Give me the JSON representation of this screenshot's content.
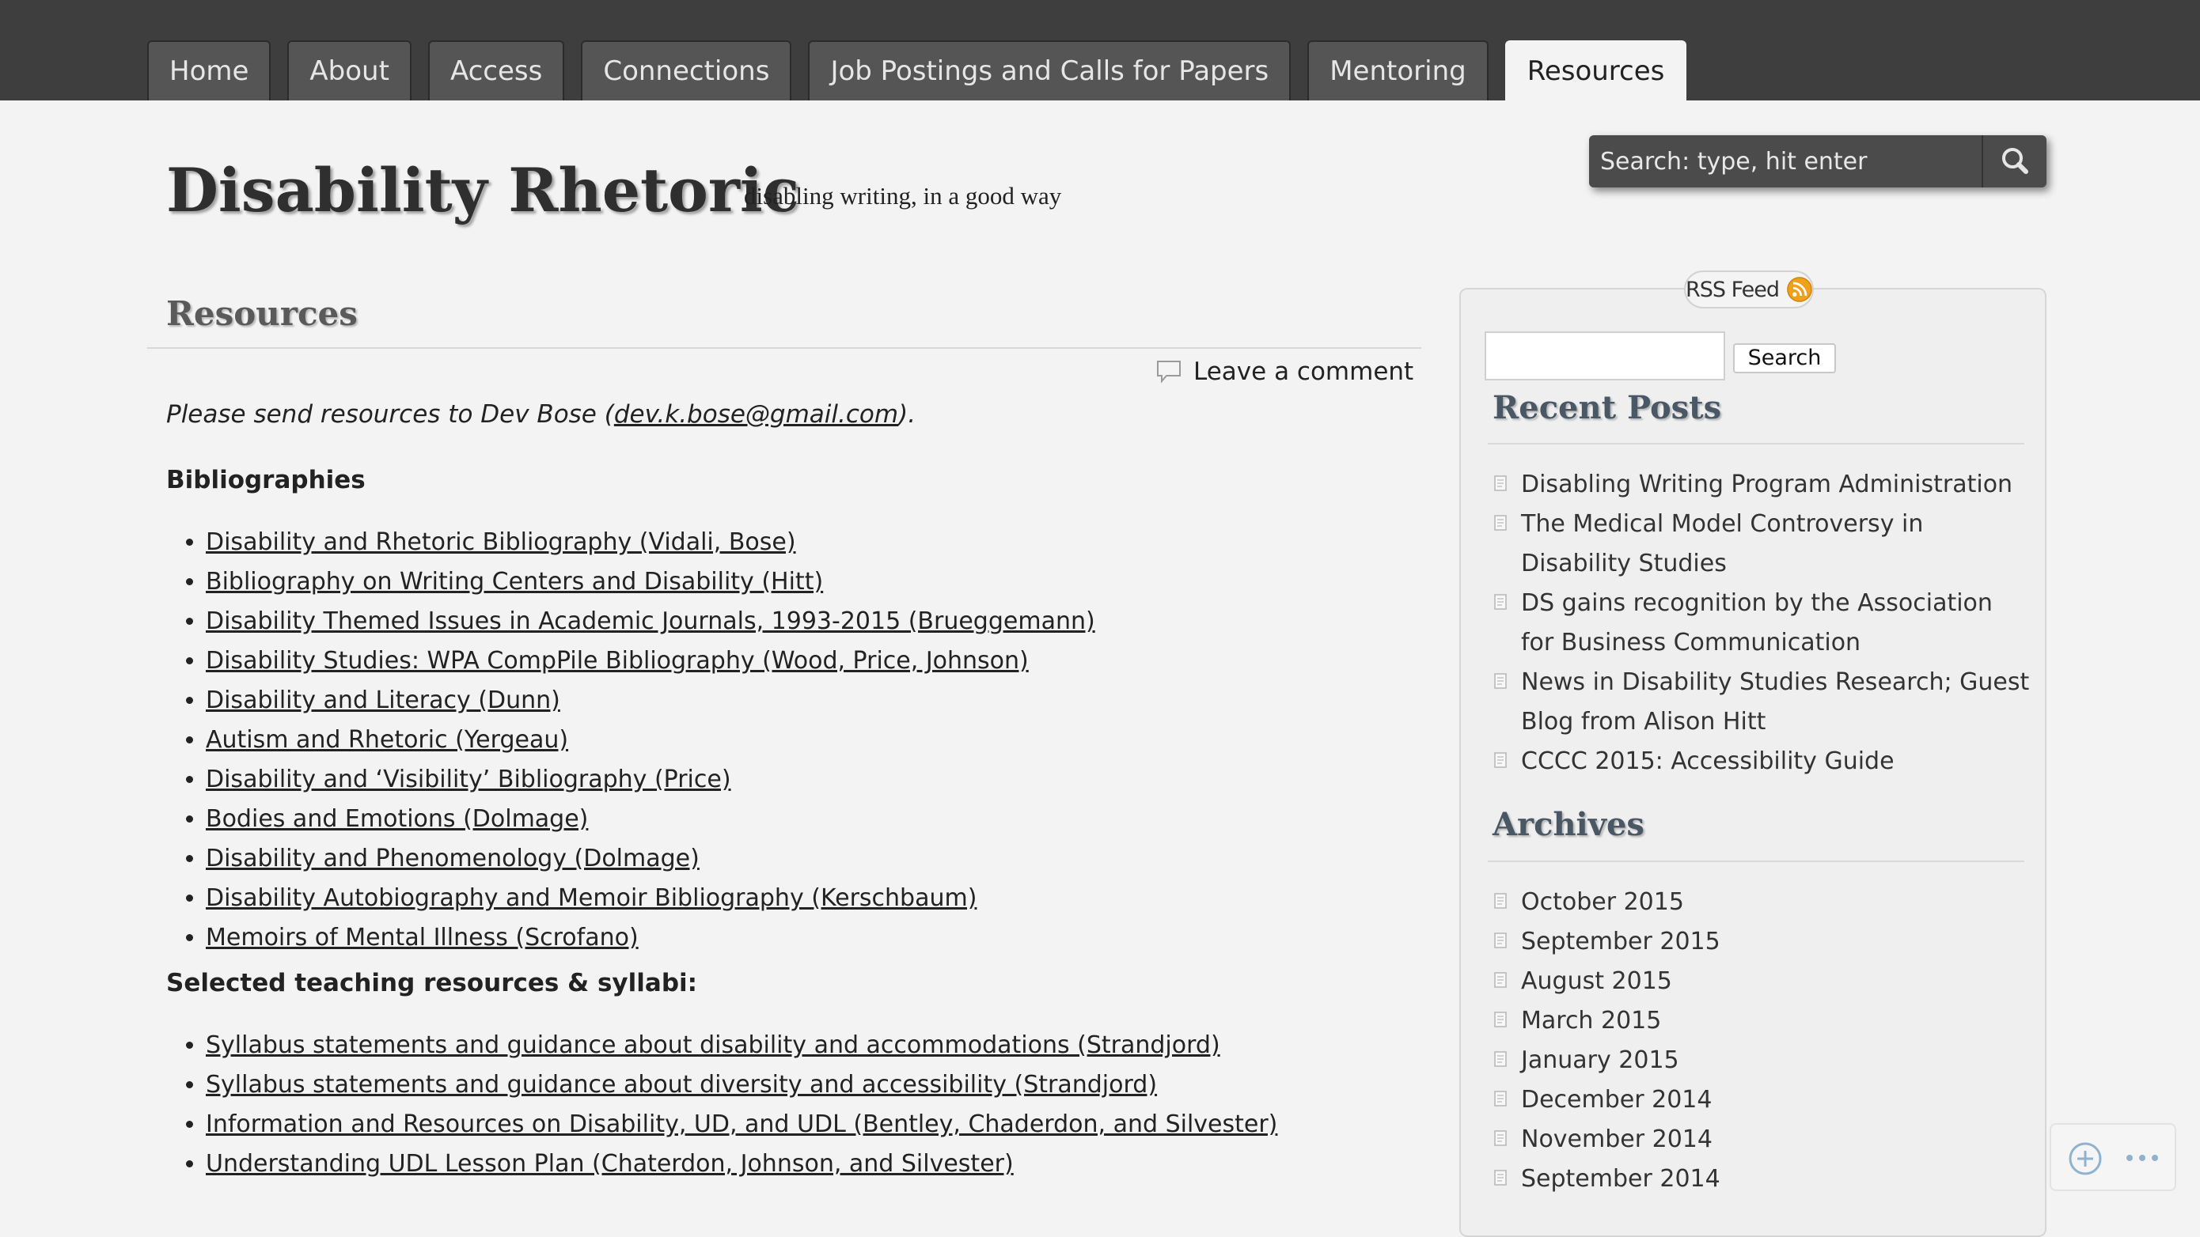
{
  "nav": {
    "tabs": [
      {
        "label": "Home",
        "active": false
      },
      {
        "label": "About",
        "active": false
      },
      {
        "label": "Access",
        "active": false
      },
      {
        "label": "Connections",
        "active": false
      },
      {
        "label": "Job Postings and Calls for Papers",
        "active": false
      },
      {
        "label": "Mentoring",
        "active": false
      },
      {
        "label": "Resources",
        "active": true
      }
    ]
  },
  "header": {
    "site_title": "Disability Rhetoric",
    "tagline": "disabling writing, in a good way",
    "search_placeholder": "Search: type, hit enter",
    "search_icon": "magnifier-icon"
  },
  "main": {
    "page_title": "Resources",
    "leave_comment": "Leave a comment",
    "intro_prefix": "Please send resources to Dev Bose (",
    "intro_email": "dev.k.bose@gmail.com",
    "intro_suffix": ").",
    "bibliographies_heading": "Bibliographies",
    "bibliographies": [
      "Disability and Rhetoric Bibliography (Vidali, Bose)",
      "Bibliography on Writing Centers and Disability (Hitt)",
      "Disability Themed Issues in Academic Journals, 1993-2015 (Brueggemann)",
      "Disability Studies: WPA CompPile Bibliography (Wood, Price, Johnson)",
      "Disability and Literacy (Dunn)",
      "Autism and Rhetoric (Yergeau)",
      "Disability and ‘Visibility’ Bibliography (Price)",
      "Bodies and Emotions (Dolmage)",
      "Disability and Phenomenology (Dolmage)",
      "Disability Autobiography and Memoir Bibliography (Kerschbaum)",
      "Memoirs of Mental Illness (Scrofano)"
    ],
    "teaching_heading": "Selected teaching resources & syllabi:",
    "teaching": [
      "Syllabus statements and guidance about disability and accommodations (Strandjord)",
      "Syllabus statements and guidance about diversity and accessibility (Strandjord)",
      "Information and Resources on Disability, UD, and UDL (Bentley, Chaderdon, and Silvester)",
      "Understanding UDL Lesson Plan (Chaterdon, Johnson, and Silvester)"
    ]
  },
  "sidebar": {
    "rss_label": "RSS Feed",
    "search_button": "Search",
    "recent_posts_title": "Recent Posts",
    "recent_posts": [
      "Disabling Writing Program Administration",
      "The Medical Model Controversy in Disability Studies",
      "DS gains recognition by the Association for Business Communication",
      "News in Disability Studies Research; Guest Blog from Alison Hitt",
      "CCCC 2015: Accessibility Guide"
    ],
    "archives_title": "Archives",
    "archives": [
      "October 2015",
      "September 2015",
      "August 2015",
      "March 2015",
      "January 2015",
      "December 2014",
      "November 2014",
      "September 2014"
    ]
  },
  "colors": {
    "nav_bg": "#3e3e3e",
    "tab_bg": "#555555",
    "page_bg": "#f3f3f3",
    "widget_title": "#4a5866",
    "rss_orange": "#f0a11a"
  }
}
